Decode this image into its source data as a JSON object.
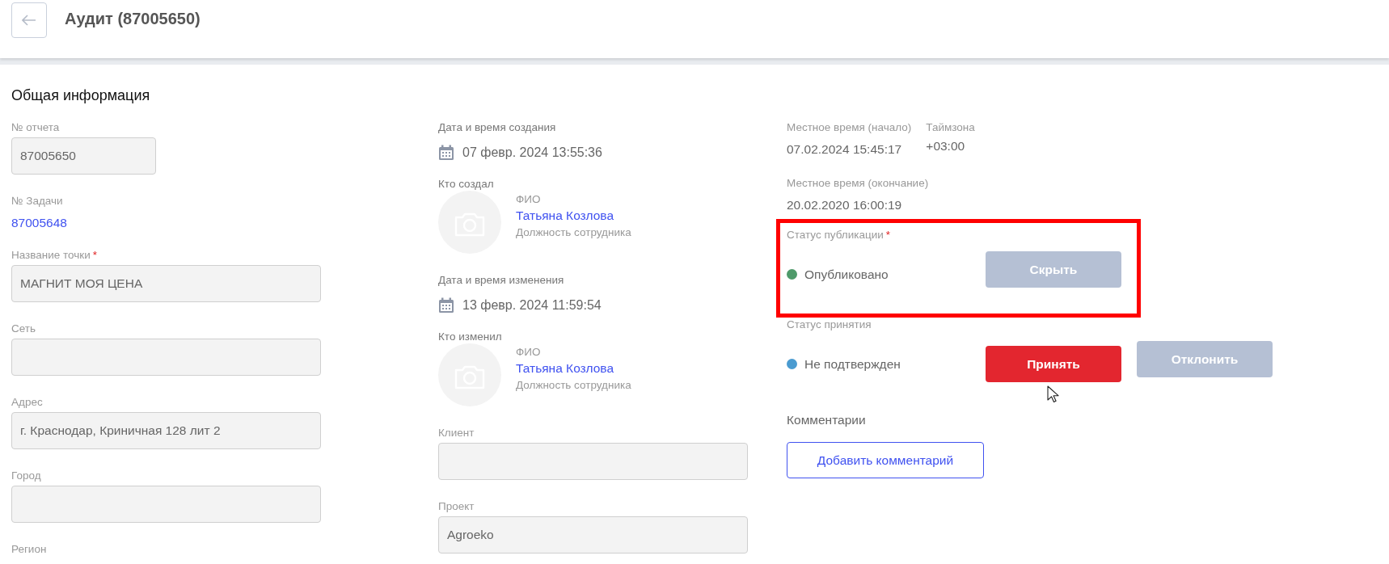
{
  "header": {
    "title": "Аудит (87005650)"
  },
  "section_title": "Общая информация",
  "left": [
    {
      "kind": "short-field",
      "label": "№ отчета",
      "value": "87005650"
    },
    {
      "kind": "link",
      "label": "№ Задачи",
      "value": "87005648"
    },
    {
      "kind": "field",
      "label": "Название точки",
      "required_mark": "*",
      "value": "МАГНИТ МОЯ ЦЕНА"
    },
    {
      "kind": "field",
      "label": "Сеть"
    },
    {
      "kind": "field",
      "label": "Адрес",
      "value": "г. Краснодар, Криничная 128 лит 2"
    },
    {
      "kind": "field",
      "label": "Город"
    },
    {
      "kind": "label",
      "label": "Регион"
    }
  ],
  "middle": [
    {
      "kind": "date",
      "label": "Дата и время создания",
      "value": "07 февр. 2024 13:55:36"
    },
    {
      "kind": "person",
      "label": "Кто создал",
      "fio_label": "ФИО",
      "name": "Татьяна Козлова",
      "position": "Должность сотрудника"
    },
    {
      "kind": "date",
      "label": "Дата и время изменения",
      "value": "13 февр. 2024 11:59:54"
    },
    {
      "kind": "person",
      "label": "Кто изменил",
      "fio_label": "ФИО",
      "name": "Татьяна Козлова",
      "position": "Должность сотрудника"
    },
    {
      "kind": "field",
      "label": "Клиент"
    },
    {
      "kind": "field",
      "label": "Проект",
      "value": "Agroeko"
    }
  ],
  "right": {
    "times": [
      {
        "label": "Местное время (начало)",
        "value": "07.02.2024 15:45:17"
      },
      {
        "label": "Таймзона",
        "value": "+03:00"
      }
    ],
    "end_time": {
      "label": "Местное время (окончание)",
      "value": "20.02.2020 16:00:19"
    },
    "statuses": [
      {
        "label": "Статус публикации",
        "required_mark": "*",
        "highlighted": true,
        "text": "Опубликовано",
        "color": "#4e9a6a",
        "buttons": [
          {
            "label": "Скрыть",
            "kind": "secondary"
          }
        ]
      },
      {
        "label": "Статус принятия",
        "text": "Не подтвержден",
        "color": "#4a9bd0",
        "buttons": [
          {
            "label": "Принять",
            "kind": "primary",
            "cursor": true
          },
          {
            "label": "Отклонить",
            "kind": "secondary"
          }
        ]
      }
    ],
    "comments": {
      "title": "Комментарии",
      "button": "Добавить комментарий"
    }
  }
}
